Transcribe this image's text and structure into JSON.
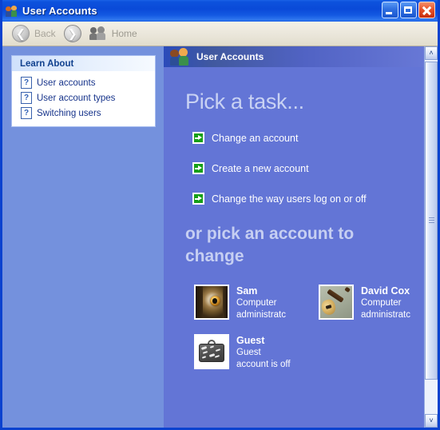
{
  "window": {
    "title": "User Accounts",
    "title_icon": "users-icon",
    "buttons": {
      "minimize": "minimize-icon",
      "maximize": "maximize-icon",
      "close": "close-icon"
    }
  },
  "toolbar": {
    "back_label": "Back",
    "back_icon": "arrow-left-circle-icon",
    "forward_icon": "arrow-right-circle-icon",
    "home_label": "Home",
    "home_icon": "users-home-icon"
  },
  "sidebar": {
    "panel_title": "Learn About",
    "links": [
      {
        "label": "User accounts",
        "icon": "help-question-icon"
      },
      {
        "label": "User account types",
        "icon": "help-question-icon"
      },
      {
        "label": "Switching users",
        "icon": "help-question-icon"
      }
    ]
  },
  "main": {
    "banner_title": "User Accounts",
    "banner_icon": "users-icon",
    "pick_task_heading": "Pick a task...",
    "tasks": [
      {
        "label": "Change an account",
        "icon": "green-arrow-icon"
      },
      {
        "label": "Create a new account",
        "icon": "green-arrow-icon"
      },
      {
        "label": "Change the way users log on or off",
        "icon": "green-arrow-icon"
      }
    ],
    "pick_account_heading": "or pick an account to change",
    "accounts": [
      {
        "name": "Sam",
        "description": "Computer administratc",
        "picture": "owl-photo"
      },
      {
        "name": "David Cox",
        "description": "Computer administratc",
        "picture": "guitar-photo"
      },
      {
        "name": "Guest",
        "description": "Guest account is off",
        "picture": "suitcase-photo"
      }
    ]
  },
  "scrollbar": {
    "up_arrow": "˄",
    "down_arrow": "˅"
  },
  "colors": {
    "title_bar_blue": "#0a4ad8",
    "sidebar_blue": "#7491dd",
    "content_blue": "#6375d6",
    "banner_gradient_start": "#2b4bba",
    "banner_gradient_end": "#6a7ad8",
    "heading_lavender": "#c9d2f3",
    "task_arrow_green": "#18a018",
    "link_navy": "#17348b",
    "panel_header_navy": "#11418e",
    "close_button_red": "#e8542a"
  }
}
